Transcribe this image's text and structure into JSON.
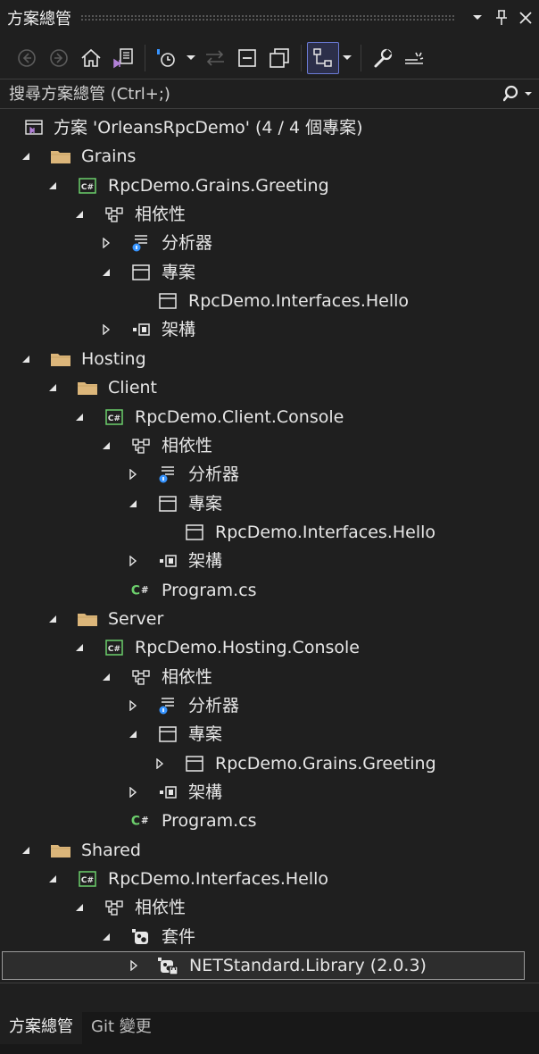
{
  "window": {
    "title": "方案總管",
    "buttons": {
      "dropdown": "▾",
      "pin": "ᵖ",
      "close": "✕"
    }
  },
  "toolbar": {
    "icons": [
      "back-icon",
      "forward-icon",
      "home-icon",
      "vs-solution-switch-icon",
      "pending-changes-filter-icon",
      "sync-active-document-icon",
      "collapse-all-icon",
      "show-all-files-icon",
      "preview-selected-icon",
      "properties-icon",
      "preview-pane-icon"
    ]
  },
  "search": {
    "placeholder": "搜尋方案總管 (Ctrl+;)"
  },
  "tree": [
    {
      "label": "方案 'OrleansRpcDemo' (4 / 4 個專案)",
      "icon": "solution-icon",
      "expander": "none",
      "indent": 0
    },
    {
      "label": "Grains",
      "icon": "folder-icon",
      "expander": "expanded",
      "indent": 0
    },
    {
      "label": "RpcDemo.Grains.Greeting",
      "icon": "csharp-project-icon",
      "expander": "expanded",
      "indent": 1
    },
    {
      "label": "相依性",
      "icon": "dependencies-icon",
      "expander": "expanded",
      "indent": 2
    },
    {
      "label": "分析器",
      "icon": "analyzers-icon",
      "expander": "collapsed",
      "indent": 3
    },
    {
      "label": "專案",
      "icon": "projects-icon",
      "expander": "expanded",
      "indent": 3
    },
    {
      "label": "RpcDemo.Interfaces.Hello",
      "icon": "project-reference-icon",
      "expander": "none",
      "indent": 4
    },
    {
      "label": "架構",
      "icon": "frameworks-icon",
      "expander": "collapsed",
      "indent": 3
    },
    {
      "label": "Hosting",
      "icon": "folder-icon",
      "expander": "expanded",
      "indent": 0
    },
    {
      "label": "Client",
      "icon": "folder-icon",
      "expander": "expanded",
      "indent": 1
    },
    {
      "label": "RpcDemo.Client.Console",
      "icon": "csharp-project-icon",
      "expander": "expanded",
      "indent": 2
    },
    {
      "label": "相依性",
      "icon": "dependencies-icon",
      "expander": "expanded",
      "indent": 3
    },
    {
      "label": "分析器",
      "icon": "analyzers-icon",
      "expander": "collapsed",
      "indent": 4
    },
    {
      "label": "專案",
      "icon": "projects-icon",
      "expander": "expanded",
      "indent": 4
    },
    {
      "label": "RpcDemo.Interfaces.Hello",
      "icon": "project-reference-icon",
      "expander": "none",
      "indent": 5
    },
    {
      "label": "架構",
      "icon": "frameworks-icon",
      "expander": "collapsed",
      "indent": 4
    },
    {
      "label": "Program.cs",
      "icon": "csharp-file-icon",
      "expander": "none",
      "indent": 3
    },
    {
      "label": "Server",
      "icon": "folder-icon",
      "expander": "expanded",
      "indent": 1
    },
    {
      "label": "RpcDemo.Hosting.Console",
      "icon": "csharp-project-icon",
      "expander": "expanded",
      "indent": 2
    },
    {
      "label": "相依性",
      "icon": "dependencies-icon",
      "expander": "expanded",
      "indent": 3
    },
    {
      "label": "分析器",
      "icon": "analyzers-icon",
      "expander": "collapsed",
      "indent": 4
    },
    {
      "label": "專案",
      "icon": "projects-icon",
      "expander": "expanded",
      "indent": 4
    },
    {
      "label": "RpcDemo.Grains.Greeting",
      "icon": "project-reference-icon",
      "expander": "collapsed",
      "indent": 5
    },
    {
      "label": "架構",
      "icon": "frameworks-icon",
      "expander": "collapsed",
      "indent": 4
    },
    {
      "label": "Program.cs",
      "icon": "csharp-file-icon",
      "expander": "none",
      "indent": 3
    },
    {
      "label": "Shared",
      "icon": "folder-icon",
      "expander": "expanded",
      "indent": 0
    },
    {
      "label": "RpcDemo.Interfaces.Hello",
      "icon": "csharp-project-icon",
      "expander": "expanded",
      "indent": 1
    },
    {
      "label": "相依性",
      "icon": "dependencies-icon",
      "expander": "expanded",
      "indent": 2
    },
    {
      "label": "套件",
      "icon": "packages-icon",
      "expander": "expanded",
      "indent": 3
    },
    {
      "label": "NETStandard.Library (2.0.3)",
      "icon": "nuget-package-icon",
      "expander": "collapsed",
      "indent": 4,
      "selected": true
    }
  ],
  "tabs": [
    {
      "label": "方案總管",
      "active": true
    },
    {
      "label": "Git 變更",
      "active": false
    }
  ]
}
